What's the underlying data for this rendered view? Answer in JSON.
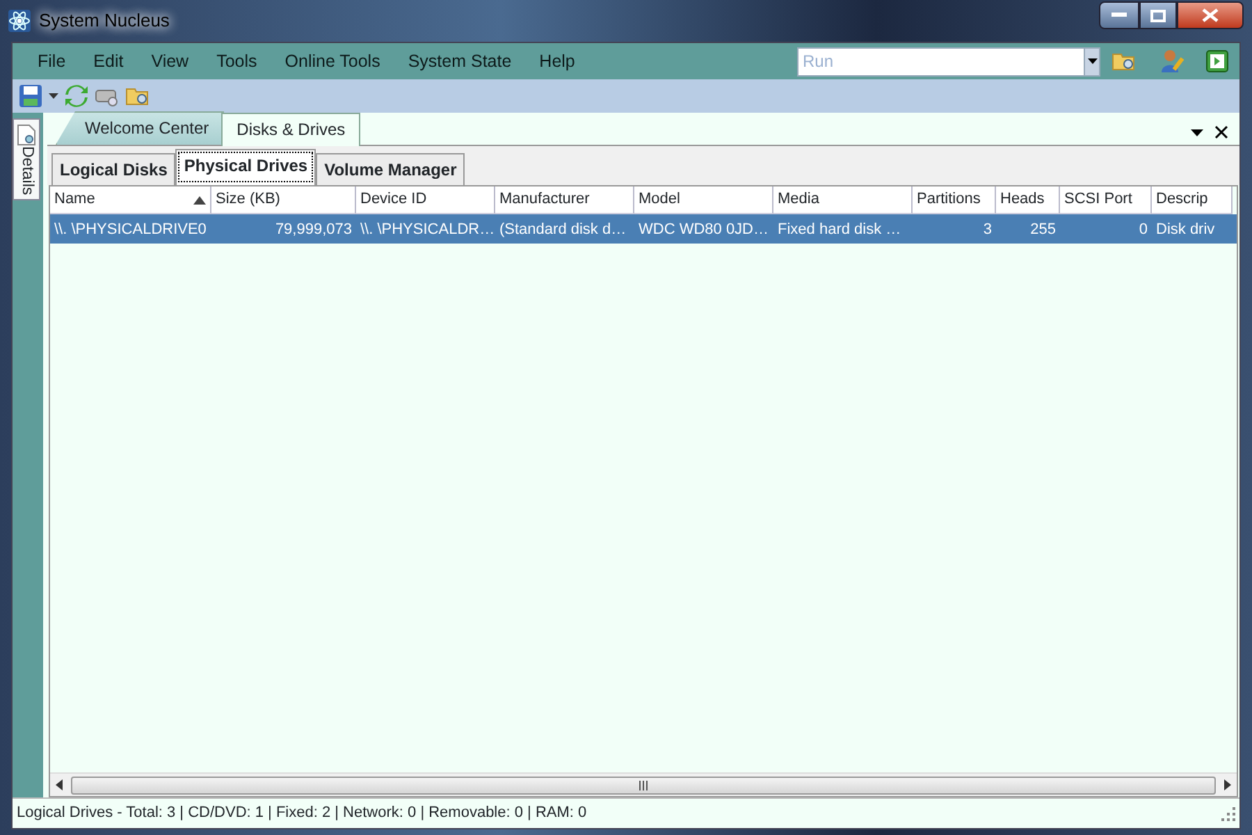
{
  "window": {
    "title": "System Nucleus"
  },
  "menu": [
    "File",
    "Edit",
    "View",
    "Tools",
    "Online Tools",
    "System State",
    "Help"
  ],
  "run_box": {
    "placeholder": "Run"
  },
  "side_tab": {
    "label": "Details"
  },
  "doc_tabs": [
    {
      "label": "Welcome Center",
      "selected": false
    },
    {
      "label": "Disks & Drives",
      "selected": true
    }
  ],
  "sub_tabs": [
    {
      "label": "Logical Disks",
      "selected": false
    },
    {
      "label": "Physical Drives",
      "selected": true
    },
    {
      "label": "Volume Manager",
      "selected": false
    }
  ],
  "table": {
    "columns": [
      {
        "label": "Name",
        "kind": "text",
        "sorted": true
      },
      {
        "label": "Size (KB)",
        "kind": "number",
        "sorted": false
      },
      {
        "label": "Device ID",
        "kind": "text",
        "sorted": false
      },
      {
        "label": "Manufacturer",
        "kind": "text",
        "sorted": false
      },
      {
        "label": "Model",
        "kind": "text",
        "sorted": false
      },
      {
        "label": "Media",
        "kind": "text",
        "sorted": false
      },
      {
        "label": "Partitions",
        "kind": "number",
        "sorted": false
      },
      {
        "label": "Heads",
        "kind": "number",
        "sorted": false
      },
      {
        "label": "SCSI Port",
        "kind": "number",
        "sorted": false
      },
      {
        "label": "Descrip",
        "kind": "text",
        "sorted": false
      }
    ],
    "rows": [
      {
        "selected": true,
        "cells": [
          "\\\\. \\PHYSICALDRIVE0",
          "79,999,073",
          "\\\\. \\PHYSICALDR…",
          "(Standard disk d…",
          "WDC WD80 0JD…",
          "Fixed hard disk …",
          "3",
          "255",
          "0",
          "Disk driv"
        ]
      }
    ]
  },
  "status_bar": "Logical Drives - Total: 3 | CD/DVD: 1 | Fixed: 2 | Network: 0 | Removable: 0 | RAM: 0"
}
